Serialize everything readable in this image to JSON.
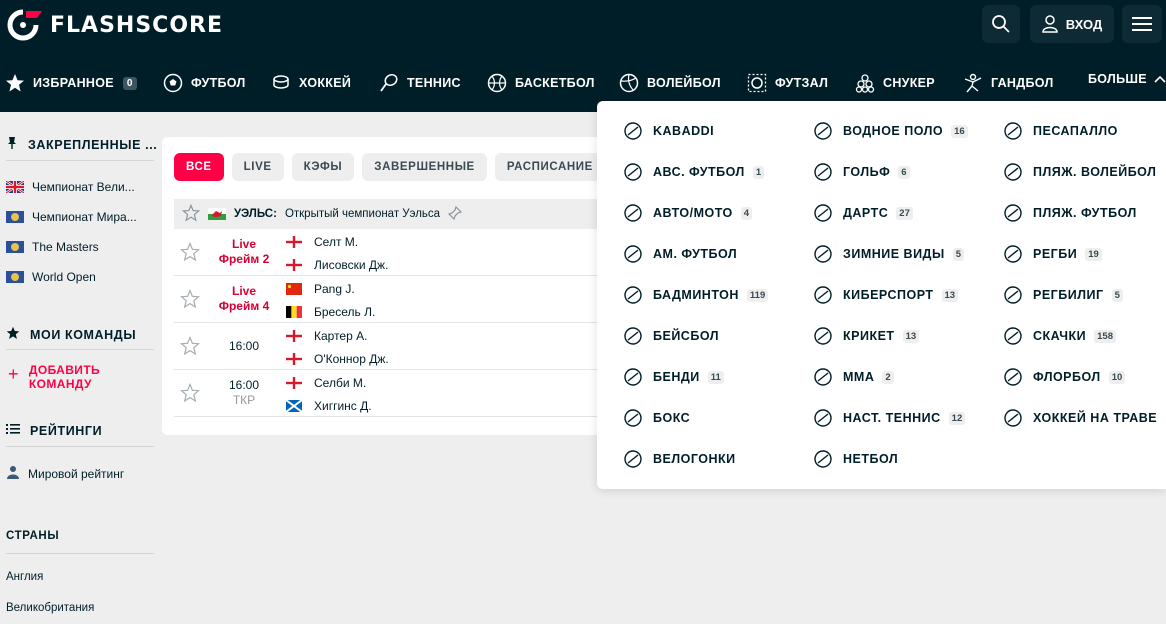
{
  "header": {
    "logo_text": "FLASHSCORE",
    "login_label": "ВХОД"
  },
  "nav": {
    "favorites": {
      "label": "ИЗБРАННОЕ",
      "count": "0"
    },
    "items": [
      {
        "label": "ФУТБОЛ",
        "icon": "soccer-ball-icon"
      },
      {
        "label": "ХОККЕЙ",
        "icon": "hockey-icon"
      },
      {
        "label": "ТЕННИС",
        "icon": "tennis-icon"
      },
      {
        "label": "БАСКЕТБОЛ",
        "icon": "basketball-icon"
      },
      {
        "label": "ВОЛЕЙБОЛ",
        "icon": "volleyball-icon"
      },
      {
        "label": "ФУТЗАЛ",
        "icon": "futsal-icon"
      },
      {
        "label": "СНУКЕР",
        "icon": "snooker-icon"
      },
      {
        "label": "ГАНДБОЛ",
        "icon": "handball-icon"
      }
    ],
    "more_label": "БОЛЬШЕ"
  },
  "sidebar": {
    "pinned_title": "ЗАКРЕПЛЕННЫЕ ...",
    "pinned": [
      {
        "label": "Чемпионат Вели..."
      },
      {
        "label": "Чемпионат Мира..."
      },
      {
        "label": "The Masters"
      },
      {
        "label": "World Open"
      }
    ],
    "teams_title": "МОИ КОМАНДЫ",
    "add_team_line1": "ДОБАВИТЬ",
    "add_team_line2": "КОМАНДУ",
    "ratings_title": "РЕЙТИНГИ",
    "world_rating": "Мировой рейтинг",
    "countries_title": "СТРАНЫ",
    "countries": [
      "Англия",
      "Великобритания"
    ]
  },
  "filters": [
    "ВСЕ",
    "LIVE",
    "КЭФЫ",
    "ЗАВЕРШЕННЫЕ",
    "РАСПИСАНИЕ"
  ],
  "league": {
    "country": "УЭЛЬС:",
    "name": "Открытый чемпионат Уэльса"
  },
  "matches": [
    {
      "time": "Live",
      "sub": "Фрейм 2",
      "live": true,
      "p1": "Селт М.",
      "p2": "Лисовски Дж."
    },
    {
      "time": "Live",
      "sub": "Фрейм 4",
      "live": true,
      "p1": "Pang J.",
      "p2": "Бресель Л."
    },
    {
      "time": "16:00",
      "sub": "",
      "live": false,
      "p1": "Картер А.",
      "p2": "О'Коннор Дж."
    },
    {
      "time": "16:00",
      "sub": "ТКР",
      "live": false,
      "p1": "Селби М.",
      "p2": "Хиггинс Д."
    }
  ],
  "dropdown": {
    "col1": [
      {
        "label": "KABADDI",
        "count": "",
        "icon": "kabaddi-icon"
      },
      {
        "label": "АВС. ФУТБОЛ",
        "count": "1",
        "icon": "aussie-football-icon"
      },
      {
        "label": "АВТО/МОТО",
        "count": "4",
        "icon": "helmet-icon"
      },
      {
        "label": "АМ. ФУТБОЛ",
        "count": "",
        "icon": "american-football-helmet-icon"
      },
      {
        "label": "БАДМИНТОН",
        "count": "119",
        "icon": "shuttlecock-icon"
      },
      {
        "label": "БЕЙСБОЛ",
        "count": "",
        "icon": "baseball-icon"
      },
      {
        "label": "БЕНДИ",
        "count": "11",
        "icon": "bandy-icon"
      },
      {
        "label": "БОКС",
        "count": "",
        "icon": "boxing-glove-icon"
      },
      {
        "label": "ВЕЛОГОНКИ",
        "count": "",
        "icon": "cycling-icon"
      }
    ],
    "col2": [
      {
        "label": "ВОДНОЕ ПОЛО",
        "count": "16",
        "icon": "water-polo-icon"
      },
      {
        "label": "ГОЛЬФ",
        "count": "6",
        "icon": "golf-icon"
      },
      {
        "label": "ДАРТС",
        "count": "27",
        "icon": "darts-icon"
      },
      {
        "label": "ЗИМНИЕ ВИДЫ",
        "count": "5",
        "icon": "snowflake-icon"
      },
      {
        "label": "КИБЕРСПОРТ",
        "count": "13",
        "icon": "gamepad-icon"
      },
      {
        "label": "КРИКЕТ",
        "count": "13",
        "icon": "cricket-icon"
      },
      {
        "label": "MMA",
        "count": "2",
        "icon": "fist-icon"
      },
      {
        "label": "НАСТ. ТЕННИС",
        "count": "12",
        "icon": "table-tennis-icon"
      },
      {
        "label": "НЕТБОЛ",
        "count": "",
        "icon": "netball-icon"
      }
    ],
    "col3": [
      {
        "label": "ПЕСАПАЛЛО",
        "count": "",
        "icon": "pesapallo-icon"
      },
      {
        "label": "ПЛЯЖ. ВОЛЕЙБОЛ",
        "count": "",
        "icon": "beach-volleyball-icon"
      },
      {
        "label": "ПЛЯЖ. ФУТБОЛ",
        "count": "",
        "icon": "beach-soccer-icon"
      },
      {
        "label": "РЕГБИ",
        "count": "19",
        "icon": "rugby-ball-icon"
      },
      {
        "label": "РЕГБИЛИГ",
        "count": "5",
        "icon": "rugby-league-icon"
      },
      {
        "label": "СКАЧКИ",
        "count": "158",
        "icon": "horse-icon"
      },
      {
        "label": "ФЛОРБОЛ",
        "count": "10",
        "icon": "floorball-icon"
      },
      {
        "label": "ХОККЕЙ НА ТРАВЕ",
        "count": "",
        "icon": "field-hockey-icon"
      }
    ]
  },
  "colors": {
    "brand_dark": "#001e28",
    "accent": "#ff0046",
    "live": "#d60033"
  }
}
